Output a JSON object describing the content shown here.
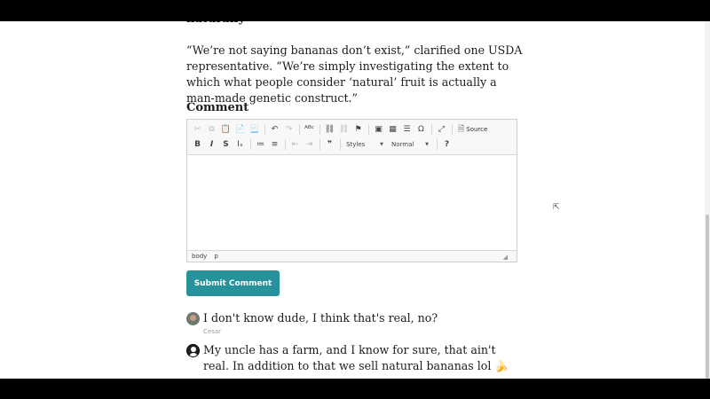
{
  "article": {
    "cut_heading": "naturally",
    "paragraph": " “We’re not saying bananas don’t exist,” clarified one USDA representative. “We’re simply investigating the extent to which what people consider ‘natural’ fruit is actually a man-made genetic construct.”"
  },
  "comment_form": {
    "heading": "Comment",
    "toolbar": {
      "source_label": "Source",
      "styles_label": "Styles",
      "format_label": "Normal",
      "help_label": "?"
    },
    "statusbar": {
      "path": [
        "body",
        "p"
      ]
    },
    "submit_label": "Submit Comment"
  },
  "comments": [
    {
      "text": "I don't know dude, I think that's real, no?",
      "author": "Cesar"
    },
    {
      "text": "My uncle has a farm, and I know for sure, that ain't real. In addition to that we sell natural bananas lol 🍌",
      "author": ""
    }
  ],
  "colors": {
    "submit_button": "#27929c",
    "frame": "#000000"
  }
}
